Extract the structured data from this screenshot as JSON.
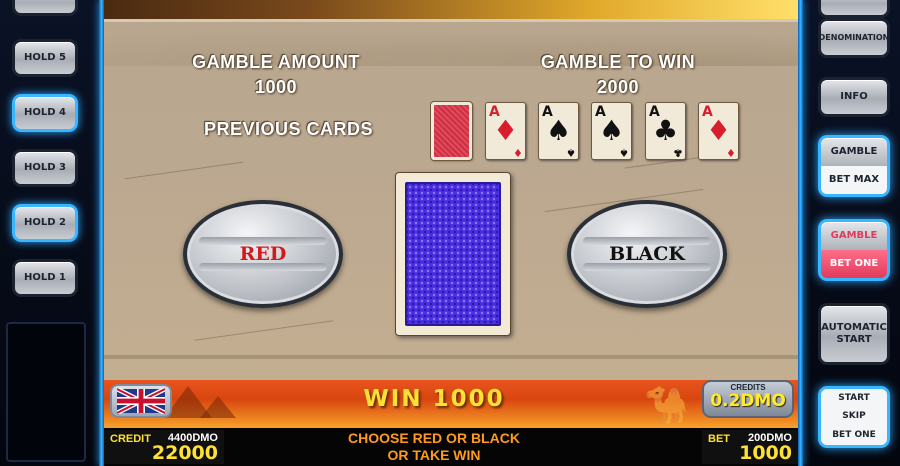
{
  "left_panel": {
    "hold_buttons": [
      {
        "label": "HOLD 5",
        "lit": false
      },
      {
        "label": "HOLD 4",
        "lit": true
      },
      {
        "label": "HOLD 3",
        "lit": false
      },
      {
        "label": "HOLD 2",
        "lit": true
      },
      {
        "label": "HOLD 1",
        "lit": false
      }
    ]
  },
  "right_panel": {
    "denomination_label": "DENOMINATION",
    "info_label": "INFO",
    "gamble_bet_max": {
      "top": "GAMBLE",
      "bottom": "BET MAX"
    },
    "gamble_bet_one": {
      "top": "GAMBLE",
      "bottom": "BET ONE"
    },
    "automatic_start": "AUTOMATIC\nSTART",
    "start_skip_betone": {
      "top": "START",
      "middle": "SKIP",
      "bottom": "BET ONE"
    }
  },
  "gamble": {
    "amount_label": "GAMBLE AMOUNT",
    "amount_value": "1000",
    "to_win_label": "GAMBLE TO WIN",
    "to_win_value": "2000",
    "previous_cards_label": "PREVIOUS CARDS",
    "previous_cards": [
      {
        "rank": "",
        "suit": "back",
        "color": "red"
      },
      {
        "rank": "A",
        "suit": "♦",
        "color": "red"
      },
      {
        "rank": "A",
        "suit": "♠",
        "color": "black"
      },
      {
        "rank": "A",
        "suit": "♠",
        "color": "black"
      },
      {
        "rank": "A",
        "suit": "♣",
        "color": "black"
      },
      {
        "rank": "A",
        "suit": "♦",
        "color": "red"
      }
    ],
    "red_button": "RED",
    "black_button": "BLACK"
  },
  "status_bar": {
    "win_text": "WIN 1000",
    "credits_caption": "CREDITS",
    "credits_value": "0.2DMO"
  },
  "footer": {
    "credit_label": "CREDIT",
    "credit_small": "4400DMO",
    "credit_big": "22000",
    "instruction_line1": "CHOOSE RED OR BLACK",
    "instruction_line2": "OR TAKE WIN",
    "bet_label": "BET",
    "bet_small": "200DMO",
    "bet_big": "1000"
  },
  "colors": {
    "red_button_text": "#d31a1a",
    "black_button_text": "#111111",
    "win_yellow": "#ffe135",
    "instruction_orange": "#ff9a1e",
    "panel_glow": "#2ba8ff"
  }
}
